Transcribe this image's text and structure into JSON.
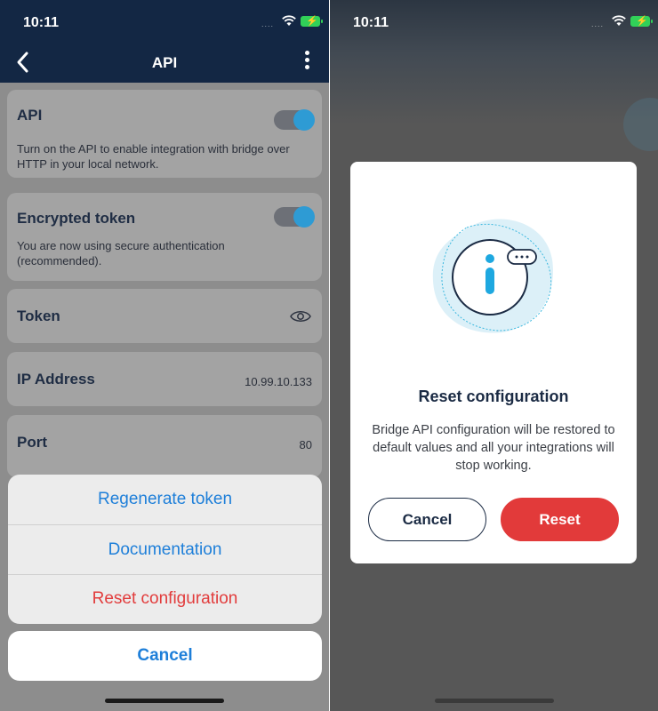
{
  "status": {
    "time_left": "10:11",
    "time_right": "10:11",
    "signal_dots": "....",
    "battery_color": "#31d158"
  },
  "nav": {
    "title": "API",
    "back_icon": "chevron-left-icon",
    "more_icon": "vertical-ellipsis-icon"
  },
  "settings": {
    "api": {
      "title": "API",
      "description": "Turn on the API to enable integration with bridge over HTTP in your local network.",
      "enabled": true
    },
    "encrypted_token": {
      "title": "Encrypted token",
      "description": "You are now using secure authentication (recommended).",
      "enabled": true
    },
    "token": {
      "title": "Token",
      "icon": "eye-icon"
    },
    "ip_address": {
      "title": "IP Address",
      "value": "10.99.10.133"
    },
    "port": {
      "title": "Port",
      "value": "80"
    }
  },
  "action_sheet": {
    "items": [
      {
        "label": "Regenerate token"
      },
      {
        "label": "Documentation"
      },
      {
        "label": "Reset configuration",
        "destructive": true
      }
    ],
    "cancel_label": "Cancel"
  },
  "dialog": {
    "icon": "info-bubble-icon",
    "title": "Reset configuration",
    "message": "Bridge API configuration will be restored to default values and all your integrations will stop working.",
    "cancel_label": "Cancel",
    "confirm_label": "Reset"
  },
  "colors": {
    "navbar": "#132744",
    "link_blue": "#1e7fd9",
    "destructive_red": "#e23a3a",
    "toggle_on": "#2e9bd4",
    "dialog_heading": "#1b2b44"
  }
}
